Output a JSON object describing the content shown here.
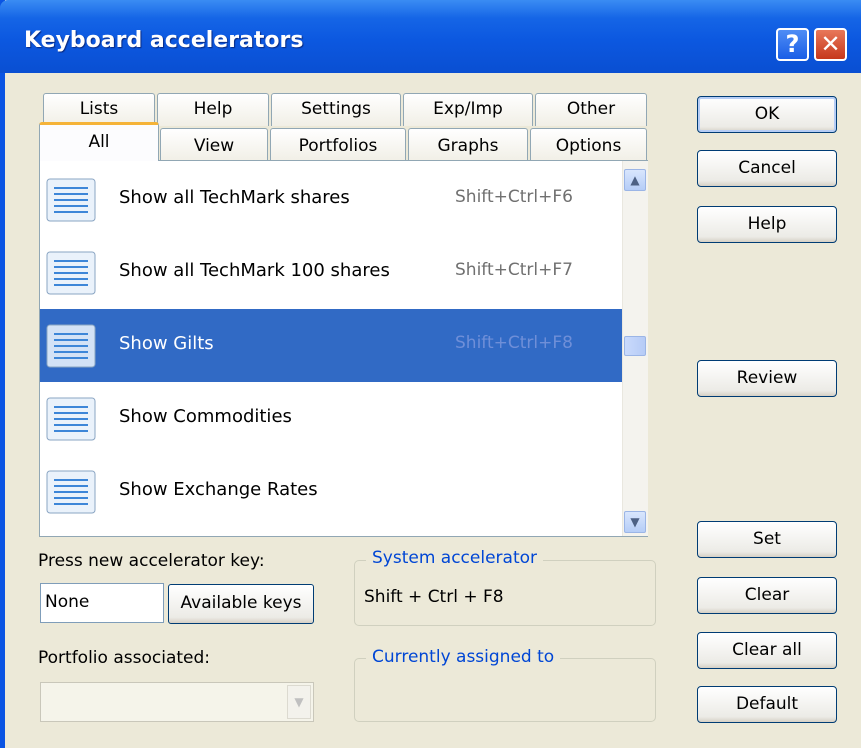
{
  "window": {
    "title": "Keyboard accelerators",
    "help_glyph": "?",
    "close_glyph": "✕"
  },
  "tabs_back": [
    {
      "label": "Lists"
    },
    {
      "label": "Help"
    },
    {
      "label": "Settings"
    },
    {
      "label": "Exp/Imp"
    },
    {
      "label": "Other"
    }
  ],
  "tabs_front": [
    {
      "label": "All",
      "active": true
    },
    {
      "label": "View"
    },
    {
      "label": "Portfolios"
    },
    {
      "label": "Graphs"
    },
    {
      "label": "Options"
    }
  ],
  "list": {
    "items": [
      {
        "label": "Show all TechMark shares",
        "shortcut": "Shift+Ctrl+F6",
        "icon": "list-icon"
      },
      {
        "label": "Show all TechMark 100 shares",
        "shortcut": "Shift+Ctrl+F7",
        "icon": "list-icon"
      },
      {
        "label": "Show Gilts",
        "shortcut": "Shift+Ctrl+F8",
        "icon": "list-icon",
        "selected": true
      },
      {
        "label": "Show Commodities",
        "shortcut": "",
        "icon": "list-icon"
      },
      {
        "label": "Show Exchange Rates",
        "shortcut": "",
        "icon": "list-icon"
      }
    ]
  },
  "buttons": {
    "ok": "OK",
    "cancel": "Cancel",
    "help": "Help",
    "review": "Review",
    "set": "Set",
    "clear": "Clear",
    "clear_all": "Clear all",
    "default": "Default"
  },
  "accelerator": {
    "label": "Press new accelerator key:",
    "value": "None",
    "available_keys": "Available keys"
  },
  "system_accelerator": {
    "title": "System accelerator",
    "value": "Shift + Ctrl + F8"
  },
  "portfolio": {
    "label": "Portfolio associated:",
    "value": ""
  },
  "currently_assigned": {
    "title": "Currently assigned to",
    "value": ""
  },
  "colors": {
    "selection": "#316ac5",
    "titlebar": "#0a54e3",
    "group_title": "#0046d5"
  }
}
